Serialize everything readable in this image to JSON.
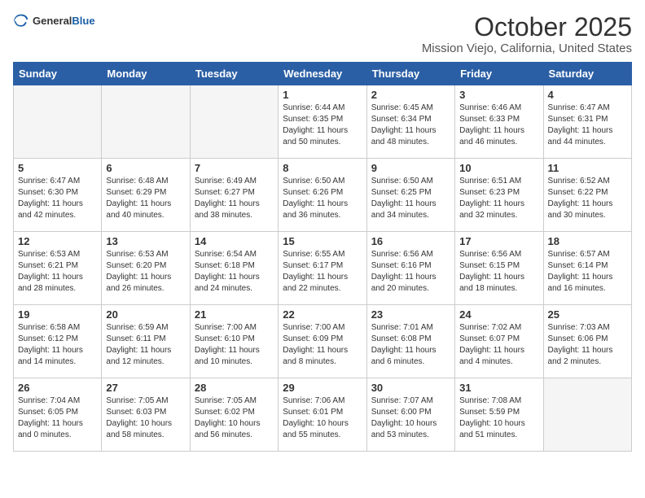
{
  "logo": {
    "general": "General",
    "blue": "Blue"
  },
  "title": "October 2025",
  "location": "Mission Viejo, California, United States",
  "weekdays": [
    "Sunday",
    "Monday",
    "Tuesday",
    "Wednesday",
    "Thursday",
    "Friday",
    "Saturday"
  ],
  "weeks": [
    [
      {
        "day": "",
        "info": ""
      },
      {
        "day": "",
        "info": ""
      },
      {
        "day": "",
        "info": ""
      },
      {
        "day": "1",
        "info": "Sunrise: 6:44 AM\nSunset: 6:35 PM\nDaylight: 11 hours\nand 50 minutes."
      },
      {
        "day": "2",
        "info": "Sunrise: 6:45 AM\nSunset: 6:34 PM\nDaylight: 11 hours\nand 48 minutes."
      },
      {
        "day": "3",
        "info": "Sunrise: 6:46 AM\nSunset: 6:33 PM\nDaylight: 11 hours\nand 46 minutes."
      },
      {
        "day": "4",
        "info": "Sunrise: 6:47 AM\nSunset: 6:31 PM\nDaylight: 11 hours\nand 44 minutes."
      }
    ],
    [
      {
        "day": "5",
        "info": "Sunrise: 6:47 AM\nSunset: 6:30 PM\nDaylight: 11 hours\nand 42 minutes."
      },
      {
        "day": "6",
        "info": "Sunrise: 6:48 AM\nSunset: 6:29 PM\nDaylight: 11 hours\nand 40 minutes."
      },
      {
        "day": "7",
        "info": "Sunrise: 6:49 AM\nSunset: 6:27 PM\nDaylight: 11 hours\nand 38 minutes."
      },
      {
        "day": "8",
        "info": "Sunrise: 6:50 AM\nSunset: 6:26 PM\nDaylight: 11 hours\nand 36 minutes."
      },
      {
        "day": "9",
        "info": "Sunrise: 6:50 AM\nSunset: 6:25 PM\nDaylight: 11 hours\nand 34 minutes."
      },
      {
        "day": "10",
        "info": "Sunrise: 6:51 AM\nSunset: 6:23 PM\nDaylight: 11 hours\nand 32 minutes."
      },
      {
        "day": "11",
        "info": "Sunrise: 6:52 AM\nSunset: 6:22 PM\nDaylight: 11 hours\nand 30 minutes."
      }
    ],
    [
      {
        "day": "12",
        "info": "Sunrise: 6:53 AM\nSunset: 6:21 PM\nDaylight: 11 hours\nand 28 minutes."
      },
      {
        "day": "13",
        "info": "Sunrise: 6:53 AM\nSunset: 6:20 PM\nDaylight: 11 hours\nand 26 minutes."
      },
      {
        "day": "14",
        "info": "Sunrise: 6:54 AM\nSunset: 6:18 PM\nDaylight: 11 hours\nand 24 minutes."
      },
      {
        "day": "15",
        "info": "Sunrise: 6:55 AM\nSunset: 6:17 PM\nDaylight: 11 hours\nand 22 minutes."
      },
      {
        "day": "16",
        "info": "Sunrise: 6:56 AM\nSunset: 6:16 PM\nDaylight: 11 hours\nand 20 minutes."
      },
      {
        "day": "17",
        "info": "Sunrise: 6:56 AM\nSunset: 6:15 PM\nDaylight: 11 hours\nand 18 minutes."
      },
      {
        "day": "18",
        "info": "Sunrise: 6:57 AM\nSunset: 6:14 PM\nDaylight: 11 hours\nand 16 minutes."
      }
    ],
    [
      {
        "day": "19",
        "info": "Sunrise: 6:58 AM\nSunset: 6:12 PM\nDaylight: 11 hours\nand 14 minutes."
      },
      {
        "day": "20",
        "info": "Sunrise: 6:59 AM\nSunset: 6:11 PM\nDaylight: 11 hours\nand 12 minutes."
      },
      {
        "day": "21",
        "info": "Sunrise: 7:00 AM\nSunset: 6:10 PM\nDaylight: 11 hours\nand 10 minutes."
      },
      {
        "day": "22",
        "info": "Sunrise: 7:00 AM\nSunset: 6:09 PM\nDaylight: 11 hours\nand 8 minutes."
      },
      {
        "day": "23",
        "info": "Sunrise: 7:01 AM\nSunset: 6:08 PM\nDaylight: 11 hours\nand 6 minutes."
      },
      {
        "day": "24",
        "info": "Sunrise: 7:02 AM\nSunset: 6:07 PM\nDaylight: 11 hours\nand 4 minutes."
      },
      {
        "day": "25",
        "info": "Sunrise: 7:03 AM\nSunset: 6:06 PM\nDaylight: 11 hours\nand 2 minutes."
      }
    ],
    [
      {
        "day": "26",
        "info": "Sunrise: 7:04 AM\nSunset: 6:05 PM\nDaylight: 11 hours\nand 0 minutes."
      },
      {
        "day": "27",
        "info": "Sunrise: 7:05 AM\nSunset: 6:03 PM\nDaylight: 10 hours\nand 58 minutes."
      },
      {
        "day": "28",
        "info": "Sunrise: 7:05 AM\nSunset: 6:02 PM\nDaylight: 10 hours\nand 56 minutes."
      },
      {
        "day": "29",
        "info": "Sunrise: 7:06 AM\nSunset: 6:01 PM\nDaylight: 10 hours\nand 55 minutes."
      },
      {
        "day": "30",
        "info": "Sunrise: 7:07 AM\nSunset: 6:00 PM\nDaylight: 10 hours\nand 53 minutes."
      },
      {
        "day": "31",
        "info": "Sunrise: 7:08 AM\nSunset: 5:59 PM\nDaylight: 10 hours\nand 51 minutes."
      },
      {
        "day": "",
        "info": ""
      }
    ]
  ]
}
